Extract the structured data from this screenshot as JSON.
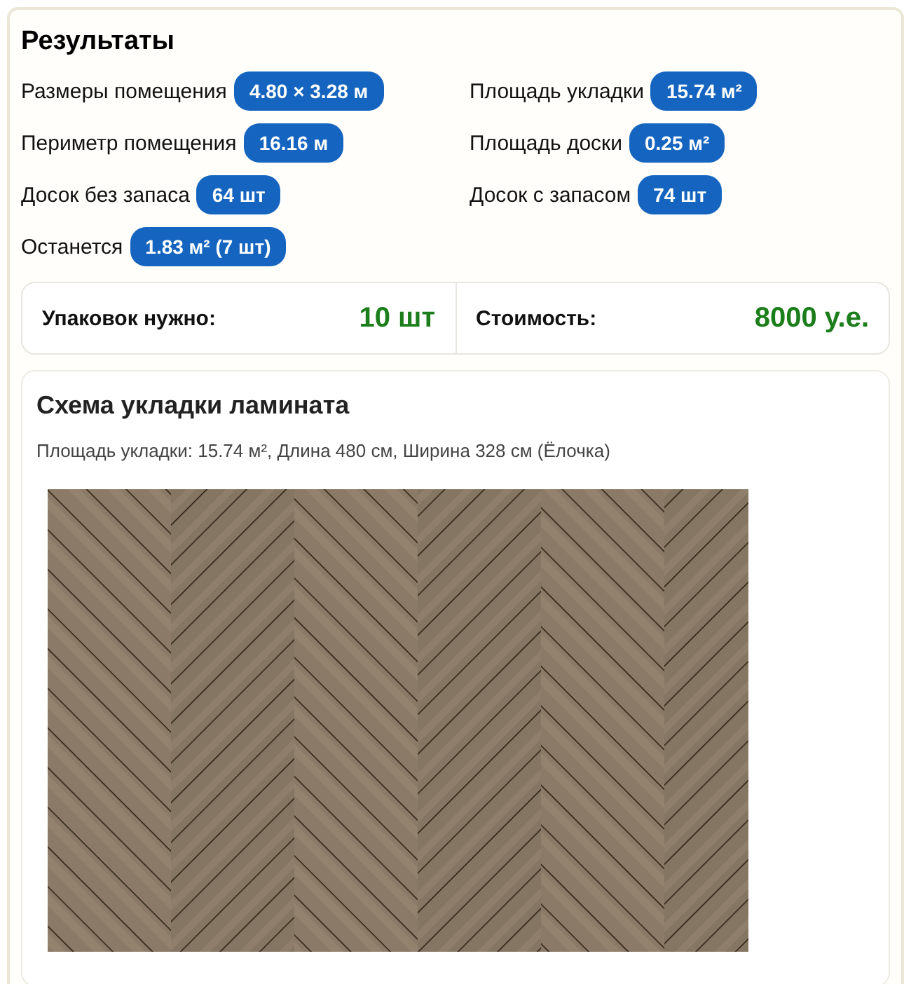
{
  "results": {
    "title": "Результаты",
    "items": [
      {
        "label": "Размеры помещения",
        "value": "4.80 × 3.28 м"
      },
      {
        "label": "Площадь укладки",
        "value": "15.74 м²"
      },
      {
        "label": "Периметр помещения",
        "value": "16.16 м"
      },
      {
        "label": "Площадь доски",
        "value": "0.25 м²"
      },
      {
        "label": "Досок без запаса",
        "value": "64 шт"
      },
      {
        "label": "Досок с запасом",
        "value": "74 шт"
      },
      {
        "label": "Останется",
        "value": "1.83 м² (7 шт)"
      }
    ]
  },
  "summary": [
    {
      "label": "Упаковок нужно:",
      "value": "10 шт"
    },
    {
      "label": "Стоимость:",
      "value": "8000 у.е."
    }
  ],
  "scheme": {
    "title": "Схема укладки ламината",
    "subtitle": "Площадь укладки: 15.74 м², Длина 480 см, Ширина 328 см (Ёлочка)"
  }
}
